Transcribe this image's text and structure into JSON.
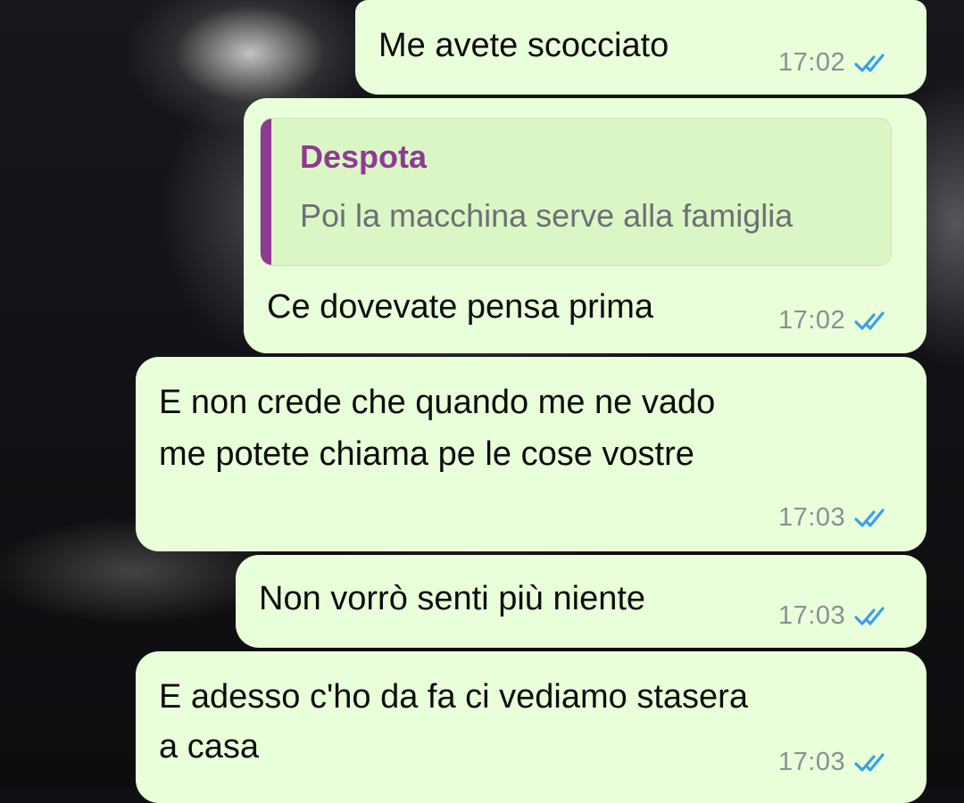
{
  "chat": {
    "messages": [
      {
        "text_lines": [
          "Me avete scocciato"
        ],
        "time": "17:02",
        "status": "read"
      },
      {
        "reply_to": {
          "author": "Despota",
          "text": "Poi la macchina serve alla famiglia"
        },
        "text_lines": [
          "Ce dovevate pensa prima"
        ],
        "time": "17:02",
        "status": "read"
      },
      {
        "text_lines": [
          "E non crede che quando me ne vado",
          "me potete chiama pe le cose vostre"
        ],
        "time": "17:03",
        "status": "read"
      },
      {
        "text_lines": [
          "Non vorrò senti più niente"
        ],
        "time": "17:03",
        "status": "read"
      },
      {
        "text_lines": [
          "E adesso c'ho da fa ci vediamo stasera",
          "a casa"
        ],
        "time": "17:03",
        "status": "read"
      }
    ]
  },
  "colors": {
    "bubble": "#e9ffd9",
    "quote_accent": "#8e3a92",
    "read_ticks": "#3aa0e8",
    "time_text": "#8b8f94"
  },
  "icons": {
    "read_receipt": "double-check-icon"
  }
}
